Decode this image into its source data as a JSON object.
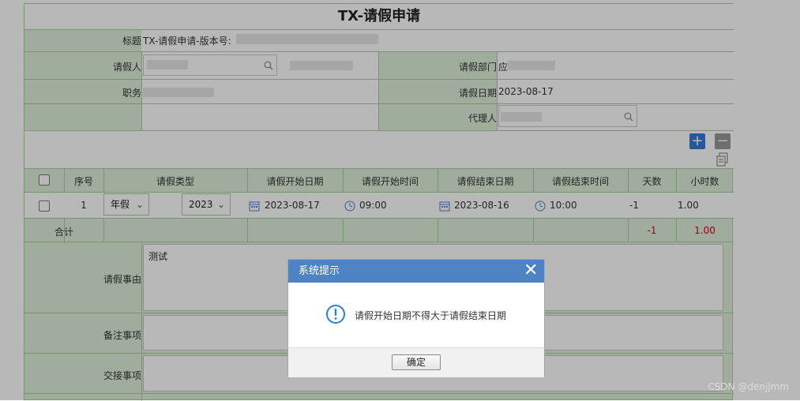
{
  "form": {
    "title": "TX-请假申请",
    "title_field_label": "标题",
    "title_field_value": "TX-请假申请-版本号:",
    "applicant_label": "请假人",
    "department_label": "请假部门",
    "department_value": "应",
    "position_label": "职务",
    "apply_date_label": "请假日期",
    "apply_date_value": "2023-08-17",
    "agent_label": "代理人"
  },
  "toolbar": {
    "add_label": "+",
    "remove_label": "−"
  },
  "table": {
    "headers": [
      "序号",
      "请假类型",
      "请假开始日期",
      "请假开始时间",
      "请假结束日期",
      "请假结束时间",
      "天数",
      "小时数"
    ],
    "row": {
      "index": "1",
      "type": "年假",
      "year": "2023",
      "start_date": "2023-08-17",
      "start_time": "09:00",
      "end_date": "2023-08-16",
      "end_time": "10:00",
      "days": "-1",
      "hours": "1.00"
    },
    "total_label": "合计",
    "total_days": "-1",
    "total_hours": "1.00"
  },
  "reason": {
    "label": "请假事由",
    "value": "测试"
  },
  "remarks": {
    "label": "备注事项"
  },
  "handover": {
    "label": "交接事项"
  },
  "dialog": {
    "title": "系统提示",
    "close_label": "✕",
    "message": "请假开始日期不得大于请假结束日期",
    "ok_label": "确定"
  },
  "watermark": "CSDN @denjjmm",
  "colors": {
    "form_bg": "#dff0d8",
    "dialog_header": "#4e83c4",
    "add_button": "#3a7bd5",
    "negative_value": "#d0021b"
  }
}
